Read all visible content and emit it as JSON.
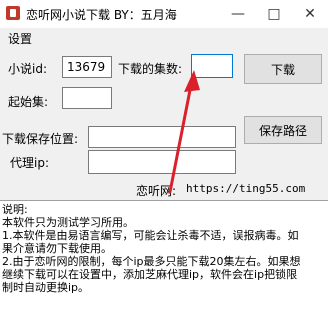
{
  "window": {
    "title": "恋听网小说下载 BY：五月海",
    "controls": [
      "—",
      "□",
      "✕"
    ]
  },
  "menu": {
    "settings": "设置"
  },
  "form": {
    "novel_id_label": "小说id:",
    "novel_id_value": "13679",
    "episodes_label": "下载的集数:",
    "episodes_value": "",
    "download_button": "下载",
    "start_label": "起始集:",
    "start_value": "",
    "save_location_label": "下载保存位置:",
    "save_location_value": "",
    "save_path_button": "保存路径",
    "proxy_label": "代理ip:",
    "proxy_value": "",
    "site_label": "恋听网:",
    "site_url": "https://ting55.com"
  },
  "notes": {
    "lines": [
      "说明:",
      "本软件只为测试学习所用。",
      "1.本软件是由易语言编写，可能会让杀毒不适，误报病毒。如",
      "果介意请勿下载使用。",
      "2.由于恋听网的限制，每个ip最多只能下载20集左右。如果想",
      "继续下载可以在设置中，添加芝麻代理ip，软件会在ip把锁限",
      "制时自动更换ip。"
    ]
  },
  "colors": {
    "accent": "#0078d7",
    "arrow": "#d9202b",
    "app_icon": "#c0392b"
  }
}
